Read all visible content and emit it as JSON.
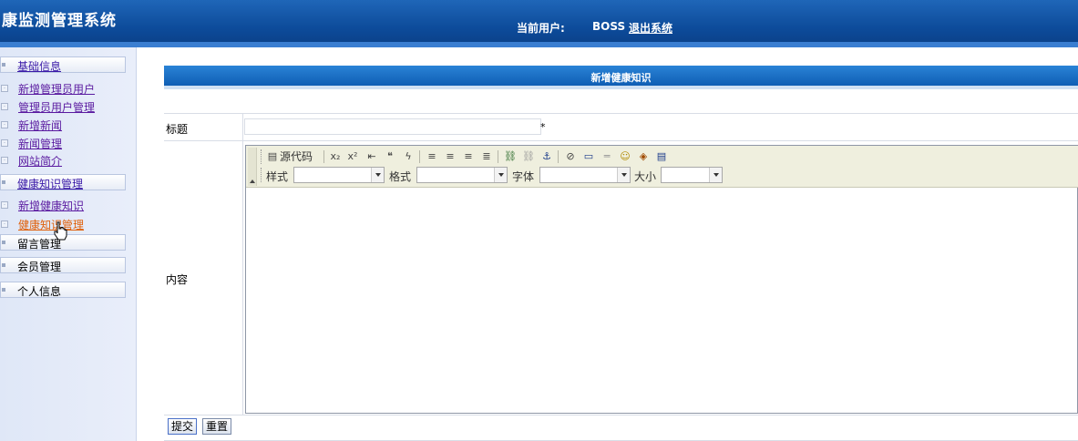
{
  "header": {
    "app_title": "康监测管理系统",
    "current_user_label": "当前用户:",
    "user_name": "BOSS",
    "logout_label": "退出系统"
  },
  "sidebar": {
    "groups": [
      {
        "label": "基础信息",
        "items": [
          "新增管理员用户",
          "管理员用户管理",
          "新增新闻",
          "新闻管理",
          "网站简介"
        ]
      },
      {
        "label": "健康知识管理",
        "items": [
          "新增健康知识",
          "健康知识管理"
        ]
      },
      {
        "label": "留言管理",
        "items": []
      },
      {
        "label": "会员管理",
        "items": []
      },
      {
        "label": "个人信息",
        "items": []
      }
    ],
    "active_item": "健康知识管理"
  },
  "main": {
    "banner_title": "新增健康知识",
    "form": {
      "title_label": "标题",
      "title_value": "",
      "required_mark": "*",
      "content_label": "内容"
    },
    "editor": {
      "source_button": "源代码",
      "style_label": "样式",
      "format_label": "格式",
      "font_label": "字体",
      "size_label": "大小",
      "style_value": "",
      "format_value": "",
      "font_value": "",
      "size_value": ""
    },
    "buttons": {
      "submit": "提交",
      "reset": "重置"
    }
  },
  "colors": {
    "header_bg": "#0d4b9a",
    "banner_bg": "#1a6fc6",
    "sidebar_bg": "#e3e9f7",
    "link_color": "#5a1aa0",
    "active_link_color": "#e0600a",
    "toolbar_bg": "#efefde"
  },
  "icons": [
    "source-icon",
    "subscript-icon",
    "superscript-icon",
    "outdent-icon",
    "blockquote-icon",
    "flash-icon",
    "align-left-icon",
    "align-center-icon",
    "align-right-icon",
    "justify-icon",
    "link-icon",
    "unlink-icon",
    "anchor-icon",
    "image-icon",
    "table-icon",
    "horizontal-rule-icon",
    "smiley-icon",
    "special-char-icon",
    "page-break-icon",
    "collapse-toolbar-icon",
    "pointer-cursor-icon"
  ]
}
